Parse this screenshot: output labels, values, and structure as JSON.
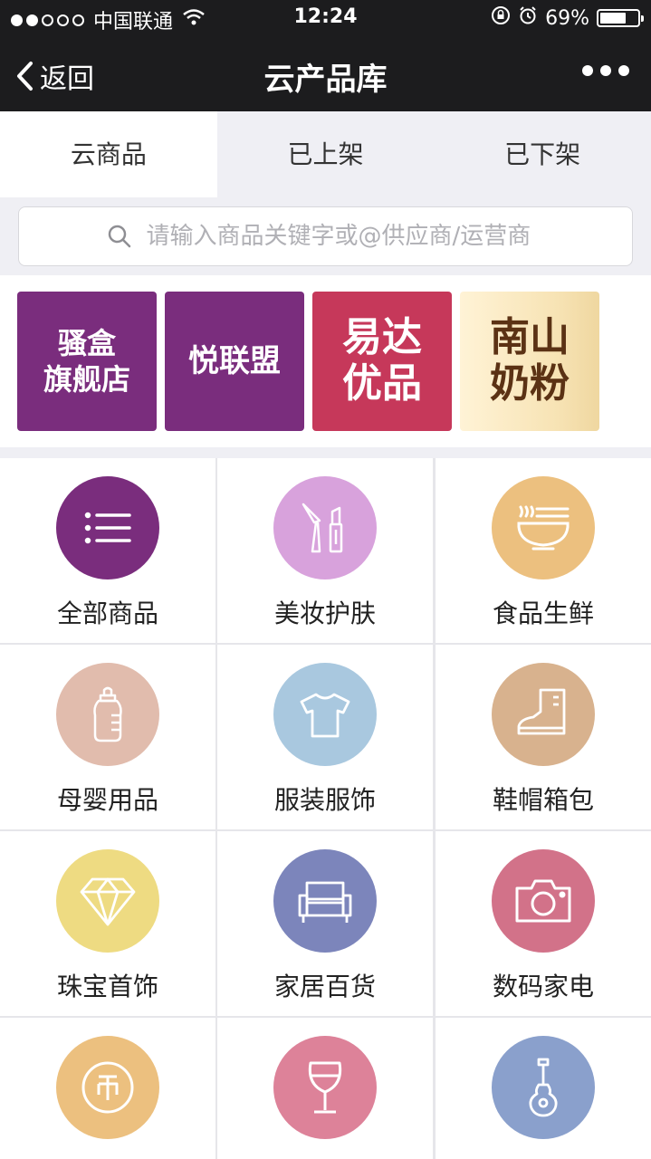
{
  "status_bar": {
    "carrier": "中国联通",
    "time": "12:24",
    "battery": "69%",
    "battery_level": 0.69
  },
  "nav": {
    "back_label": "返回",
    "title": "云产品库"
  },
  "tabs": [
    {
      "label": "云商品",
      "active": true
    },
    {
      "label": "已上架",
      "active": false
    },
    {
      "label": "已下架",
      "active": false
    }
  ],
  "search": {
    "placeholder": "请输入商品关键字或@供应商/运营商"
  },
  "banners": [
    {
      "line1": "骚盒",
      "line2": "旗舰店",
      "color": "#7a2d7d"
    },
    {
      "line1": "悦联盟",
      "line2": "",
      "color": "#7a2d7d"
    },
    {
      "line1": "易达",
      "line2": "优品",
      "color": "#c6385a"
    },
    {
      "line1": "南山",
      "line2": "奶粉",
      "color": "#f7e3b4"
    }
  ],
  "categories": [
    {
      "label": "全部商品",
      "icon": "list-icon",
      "color": "#7a2d7d"
    },
    {
      "label": "美妆护肤",
      "icon": "makeup-icon",
      "color": "#d8a2dc"
    },
    {
      "label": "食品生鲜",
      "icon": "noodle-bowl-icon",
      "color": "#ecc07f"
    },
    {
      "label": "母婴用品",
      "icon": "baby-bottle-icon",
      "color": "#e1bcad"
    },
    {
      "label": "服装服饰",
      "icon": "tshirt-icon",
      "color": "#a9c8df"
    },
    {
      "label": "鞋帽箱包",
      "icon": "boot-icon",
      "color": "#d8b28e"
    },
    {
      "label": "珠宝首饰",
      "icon": "diamond-icon",
      "color": "#eedb82"
    },
    {
      "label": "家居百货",
      "icon": "sofa-icon",
      "color": "#7c85bb"
    },
    {
      "label": "数码家电",
      "icon": "camera-icon",
      "color": "#d27289"
    },
    {
      "label": "",
      "icon": "coin-icon",
      "color": "#ecc07f"
    },
    {
      "label": "",
      "icon": "wine-glass-icon",
      "color": "#dd8299"
    },
    {
      "label": "",
      "icon": "guitar-icon",
      "color": "#8aa0cc"
    }
  ]
}
